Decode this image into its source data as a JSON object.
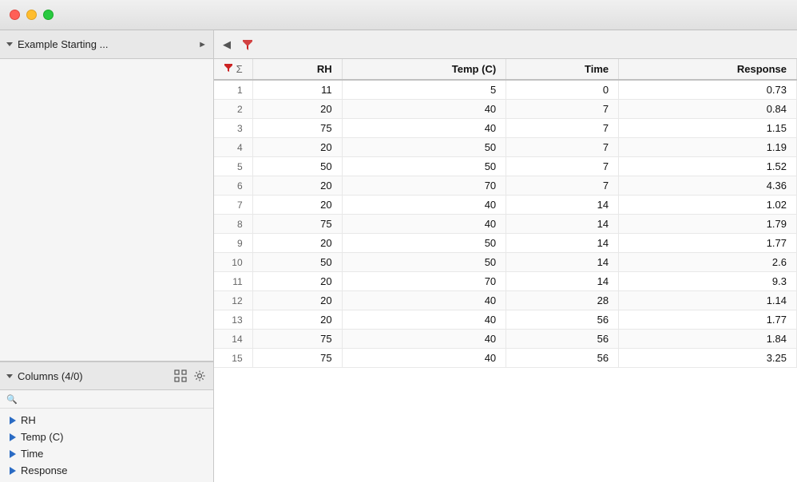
{
  "titlebar": {
    "traffic_lights": [
      "close",
      "minimize",
      "maximize"
    ]
  },
  "sidebar": {
    "datasource": {
      "label": "Example Starting ...",
      "expanded": true
    },
    "columns": {
      "label": "Columns (4/0)",
      "search_placeholder": "",
      "items": [
        {
          "name": "RH"
        },
        {
          "name": "Temp (C)"
        },
        {
          "name": "Time"
        },
        {
          "name": "Response"
        }
      ]
    }
  },
  "table": {
    "columns": [
      {
        "key": "row",
        "label": "",
        "is_row_num": true
      },
      {
        "key": "RH",
        "label": "RH"
      },
      {
        "key": "Temp",
        "label": "Temp (C)"
      },
      {
        "key": "Time",
        "label": "Time"
      },
      {
        "key": "Response",
        "label": "Response"
      }
    ],
    "rows": [
      {
        "row": 1,
        "RH": 11,
        "Temp": 5,
        "Time": 0,
        "Response": "0.73"
      },
      {
        "row": 2,
        "RH": 20,
        "Temp": 40,
        "Time": 7,
        "Response": "0.84"
      },
      {
        "row": 3,
        "RH": 75,
        "Temp": 40,
        "Time": 7,
        "Response": "1.15"
      },
      {
        "row": 4,
        "RH": 20,
        "Temp": 50,
        "Time": 7,
        "Response": "1.19"
      },
      {
        "row": 5,
        "RH": 50,
        "Temp": 50,
        "Time": 7,
        "Response": "1.52"
      },
      {
        "row": 6,
        "RH": 20,
        "Temp": 70,
        "Time": 7,
        "Response": "4.36"
      },
      {
        "row": 7,
        "RH": 20,
        "Temp": 40,
        "Time": 14,
        "Response": "1.02"
      },
      {
        "row": 8,
        "RH": 75,
        "Temp": 40,
        "Time": 14,
        "Response": "1.79"
      },
      {
        "row": 9,
        "RH": 20,
        "Temp": 50,
        "Time": 14,
        "Response": "1.77"
      },
      {
        "row": 10,
        "RH": 50,
        "Temp": 50,
        "Time": 14,
        "Response": "2.6"
      },
      {
        "row": 11,
        "RH": 20,
        "Temp": 70,
        "Time": 14,
        "Response": "9.3"
      },
      {
        "row": 12,
        "RH": 20,
        "Temp": 40,
        "Time": 28,
        "Response": "1.14"
      },
      {
        "row": 13,
        "RH": 20,
        "Temp": 40,
        "Time": 56,
        "Response": "1.77"
      },
      {
        "row": 14,
        "RH": 75,
        "Temp": 40,
        "Time": 56,
        "Response": "1.84"
      },
      {
        "row": 15,
        "RH": 75,
        "Temp": 40,
        "Time": 56,
        "Response": "3.25"
      }
    ]
  },
  "toolbar": {
    "back_arrow_label": "◀",
    "filter_dropdown_label": "▼"
  }
}
